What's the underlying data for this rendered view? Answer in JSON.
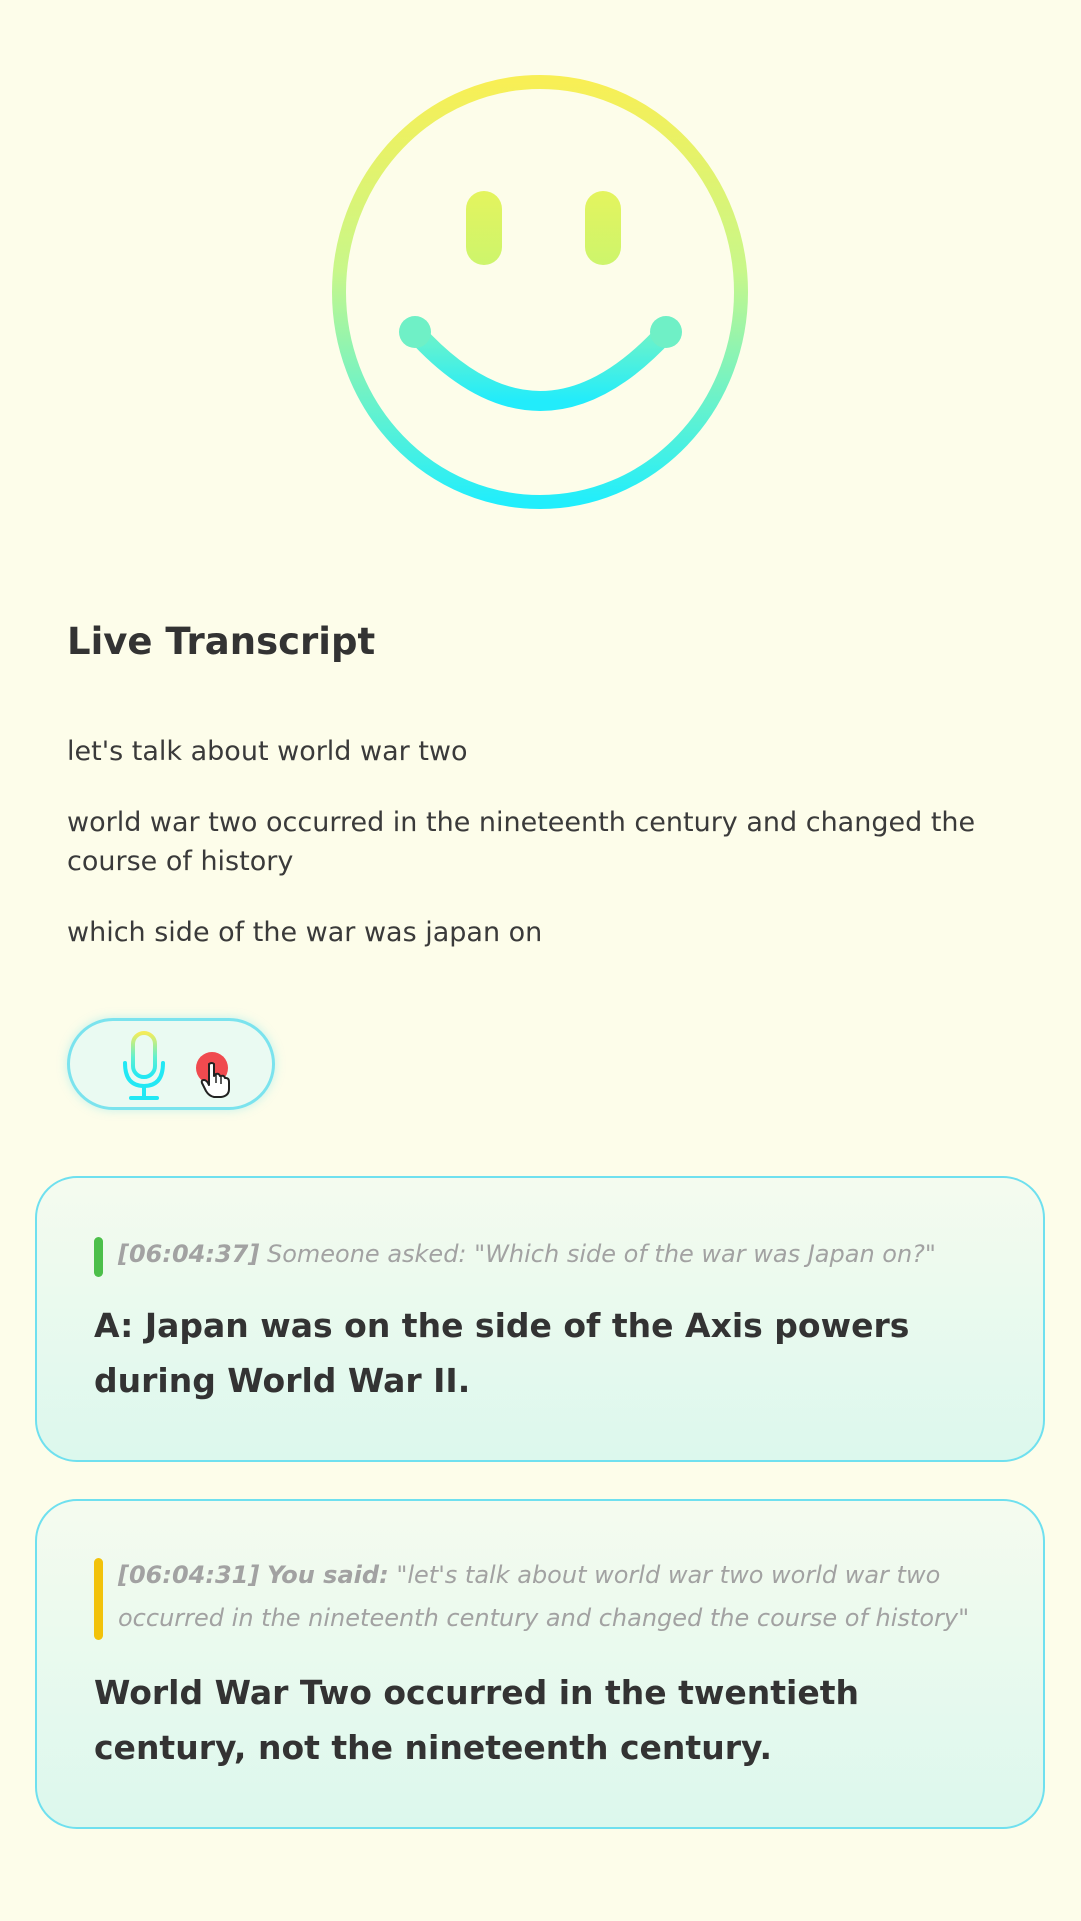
{
  "avatar": {
    "icon": "smiley-face-icon",
    "gradient_top": "#f8ef55",
    "gradient_bottom": "#21eefc"
  },
  "transcript": {
    "title": "Live Transcript",
    "lines": [
      "let's talk about world war two",
      "world war two occurred in the nineteenth century and changed the course of history",
      "which side of the war was japan on"
    ]
  },
  "record_control": {
    "mic_icon": "microphone-icon",
    "status_icon": "recording-dot-icon",
    "status_color": "#f04a4f"
  },
  "cards": [
    {
      "timestamp": "[06:04:37]",
      "speaker": "Someone asked:",
      "quote": "\"Which side of the war was Japan on?\"",
      "answer": "A: Japan was on the side of the Axis powers during World War II.",
      "bar_color": "#4cbf4a"
    },
    {
      "timestamp": "[06:04:31]",
      "speaker": "You said:",
      "quote": "\"let's talk about world war two world war two occurred in the nineteenth century and changed the course of history\"",
      "answer": "World War Two occurred in the twentieth century, not the nineteenth century.",
      "bar_color": "#f2c20a"
    }
  ]
}
